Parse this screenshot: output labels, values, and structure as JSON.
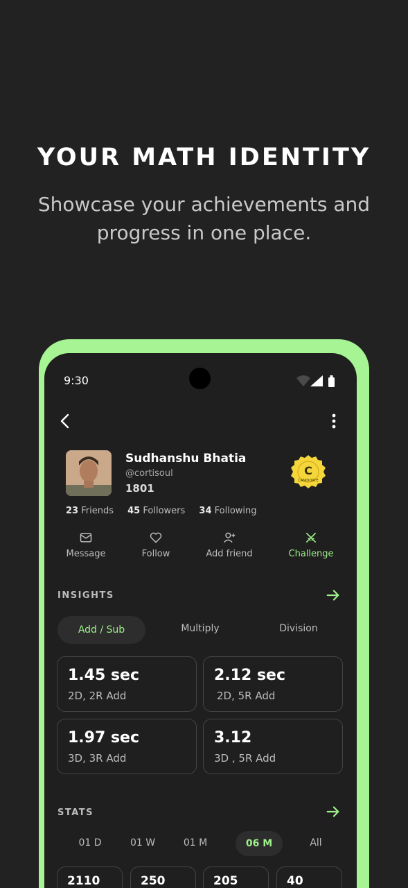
{
  "promo": {
    "headline": "YOUR MATH IDENTITY",
    "subheadline": "Showcase your achievements and progress in one place."
  },
  "status_bar": {
    "time": "9:30"
  },
  "profile": {
    "name": "Sudhanshu Bhatia",
    "handle": "@cortisoul",
    "rating": "1801",
    "badge_letter": "C",
    "badge_text": "CANDIDATE",
    "friends_count": "23",
    "friends_label": "Friends",
    "followers_count": "45",
    "followers_label": "Followers",
    "following_count": "34",
    "following_label": "Following"
  },
  "actions": [
    {
      "label": "Message",
      "icon": "mail-icon"
    },
    {
      "label": "Follow",
      "icon": "heart-icon"
    },
    {
      "label": "Add friend",
      "icon": "add-user-icon"
    },
    {
      "label": "Challenge",
      "icon": "swords-icon"
    }
  ],
  "insights": {
    "title": "INSIGHTS",
    "tabs": [
      "Add / Sub",
      "Multiply",
      "Division"
    ],
    "active_tab": "Add / Sub",
    "cards": [
      {
        "value": "1.45 sec",
        "label": "2D, 2R Add"
      },
      {
        "value": "2.12 sec",
        "label": "2D, 5R Add"
      },
      {
        "value": "1.97 sec",
        "label": "3D, 3R Add"
      },
      {
        "value": "3.12",
        "label": "3D , 5R Add"
      }
    ]
  },
  "stats": {
    "title": "STATS",
    "periods": [
      "01 D",
      "01 W",
      "01 M",
      "06 M",
      "All"
    ],
    "active_period": "06 M",
    "values": [
      "2110",
      "250",
      "205",
      "40"
    ]
  },
  "colors": {
    "accent": "#9ef08a",
    "frame": "#a6f493",
    "background": "#222222",
    "badge": "#f5d63a"
  }
}
